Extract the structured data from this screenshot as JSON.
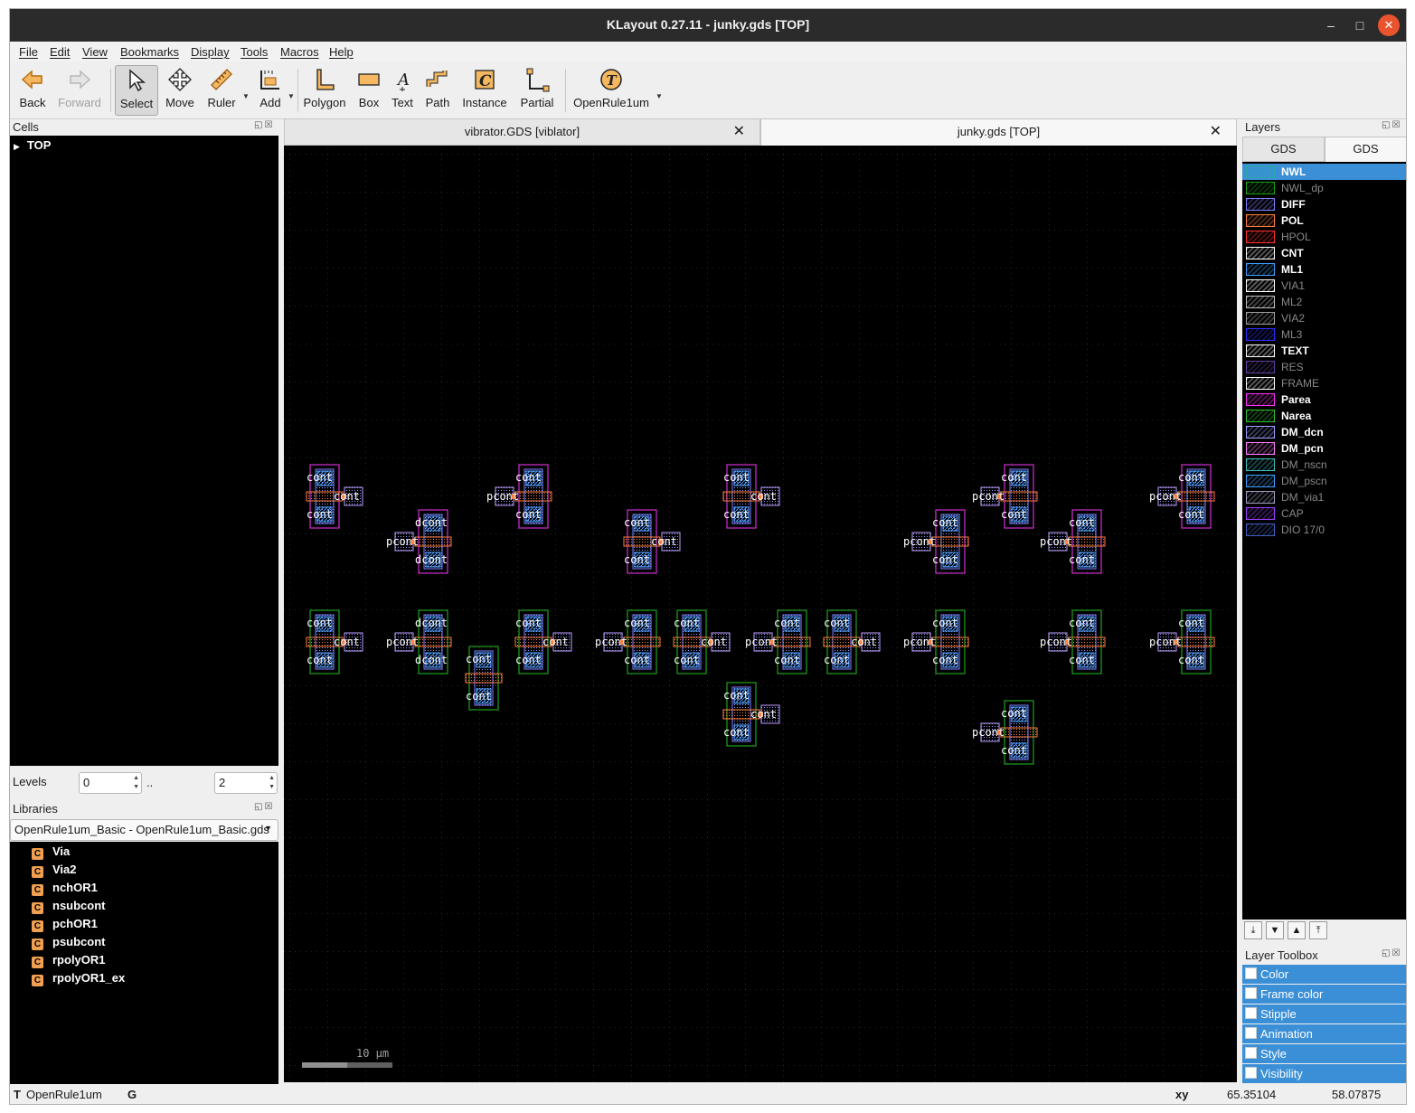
{
  "window": {
    "title": "KLayout 0.27.11 - junky.gds [TOP]"
  },
  "menu": [
    "File",
    "Edit",
    "View",
    "Bookmarks",
    "Display",
    "Tools",
    "Macros",
    "Help"
  ],
  "toolbar": {
    "back": "Back",
    "forward": "Forward",
    "select": "Select",
    "move": "Move",
    "ruler": "Ruler",
    "add": "Add",
    "polygon": "Polygon",
    "box": "Box",
    "text": "Text",
    "path": "Path",
    "instance": "Instance",
    "partial": "Partial",
    "tech": "OpenRule1um"
  },
  "cells": {
    "title": "Cells",
    "top_cell": "TOP"
  },
  "levels": {
    "label": "Levels",
    "from": "0",
    "sep": "..",
    "to": "2"
  },
  "libraries": {
    "title": "Libraries",
    "selected": "OpenRule1um_Basic - OpenRule1um_Basic.gds",
    "items": [
      "Via",
      "Via2",
      "nchOR1",
      "nsubcont",
      "pchOR1",
      "psubcont",
      "rpolyOR1",
      "rpolyOR1_ex"
    ],
    "icon_letter": "C"
  },
  "tabs": [
    {
      "label": "vibrator.GDS [viblator]",
      "close": "✕"
    },
    {
      "label": "junky.gds [TOP]",
      "close": "✕"
    }
  ],
  "canvas": {
    "scale_label": "10 μm",
    "labels": {
      "cont": "cont",
      "pcont": "pcont",
      "dcont": "dcont"
    }
  },
  "layers": {
    "title": "Layers",
    "tabs": [
      "GDS",
      "GDS"
    ],
    "items": [
      {
        "name": "NWL",
        "color": "#2aa8a8",
        "visible": true,
        "selected": true
      },
      {
        "name": "NWL_dp",
        "color": "#18a018",
        "visible": false
      },
      {
        "name": "DIFF",
        "color": "#8080ff",
        "visible": true
      },
      {
        "name": "POL",
        "color": "#ff8040",
        "visible": true
      },
      {
        "name": "HPOL",
        "color": "#ff3030",
        "visible": false
      },
      {
        "name": "CNT",
        "color": "#ffffff",
        "visible": true
      },
      {
        "name": "ML1",
        "color": "#40a0ff",
        "visible": true
      },
      {
        "name": "VIA1",
        "color": "#ffffff",
        "visible": false
      },
      {
        "name": "ML2",
        "color": "#c0c0c0",
        "visible": false
      },
      {
        "name": "VIA2",
        "color": "#a0a0a0",
        "visible": false
      },
      {
        "name": "ML3",
        "color": "#3030ff",
        "visible": false
      },
      {
        "name": "TEXT",
        "color": "#ffffff",
        "visible": true
      },
      {
        "name": "RES",
        "color": "#6040a0",
        "visible": false
      },
      {
        "name": "FRAME",
        "color": "#ffffff",
        "visible": false
      },
      {
        "name": "Parea",
        "color": "#ff30ff",
        "visible": true
      },
      {
        "name": "Narea",
        "color": "#30c030",
        "visible": true
      },
      {
        "name": "DM_dcn",
        "color": "#a0a0ff",
        "visible": true
      },
      {
        "name": "DM_pcn",
        "color": "#ff80ff",
        "visible": true
      },
      {
        "name": "DM_nscn",
        "color": "#40c0c0",
        "visible": false
      },
      {
        "name": "DM_pscn",
        "color": "#40a0ff",
        "visible": false
      },
      {
        "name": "DM_via1",
        "color": "#a0a0c0",
        "visible": false
      },
      {
        "name": "CAP",
        "color": "#a040ff",
        "visible": false
      },
      {
        "name": "DIO 17/0",
        "color": "#4060c0",
        "visible": false
      }
    ]
  },
  "layer_toolbox": {
    "title": "Layer Toolbox",
    "items": [
      "Color",
      "Frame color",
      "Stipple",
      "Animation",
      "Style",
      "Visibility"
    ]
  },
  "status": {
    "tech": "OpenRule1um",
    "t": "T",
    "g": "G",
    "coord_label": "xy",
    "x": "65.35104",
    "y": "58.07875"
  }
}
